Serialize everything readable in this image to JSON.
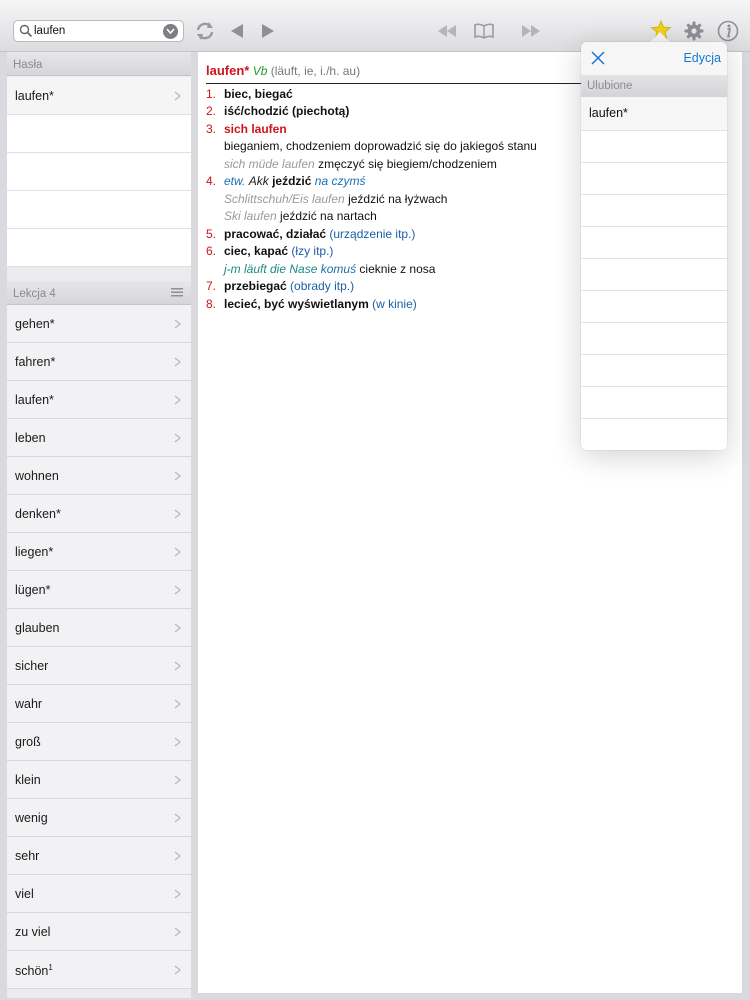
{
  "search": {
    "value": "laufen"
  },
  "colors": {
    "accent": "#1477d6",
    "headword": "#d0131b",
    "pos": "#1f9d2a",
    "star_active": "#f2d21b"
  },
  "toolbar": {
    "icons": [
      "search-icon",
      "clear-icon",
      "sync-icon",
      "back-icon",
      "forward-icon",
      "rewind-icon",
      "book-icon",
      "favorites-star-icon",
      "settings-gear-icon",
      "info-icon"
    ]
  },
  "sidebar": {
    "entries_header": "Hasła",
    "entries": [
      {
        "label": "laufen*"
      },
      {
        "label": ""
      },
      {
        "label": ""
      },
      {
        "label": ""
      },
      {
        "label": ""
      }
    ],
    "lesson_header": "Lekcja 4",
    "lesson_items": [
      {
        "label": "gehen*"
      },
      {
        "label": "fahren*"
      },
      {
        "label": "laufen*"
      },
      {
        "label": "leben"
      },
      {
        "label": "wohnen"
      },
      {
        "label": "denken*"
      },
      {
        "label": "liegen*"
      },
      {
        "label": "lügen*"
      },
      {
        "label": "glauben"
      },
      {
        "label": "sicher"
      },
      {
        "label": "wahr"
      },
      {
        "label": "groß"
      },
      {
        "label": "klein"
      },
      {
        "label": "wenig"
      },
      {
        "label": "sehr"
      },
      {
        "label": "viel"
      },
      {
        "label": "zu viel"
      },
      {
        "label": "schön",
        "sup": "1"
      }
    ]
  },
  "entry": {
    "headword": "laufen*",
    "pos": "Vb",
    "grammar": "(läuft, ie, i./h. au)",
    "senses": [
      {
        "num": "1.",
        "tr": "biec, biegać"
      },
      {
        "num": "2.",
        "tr": "iść/chodzić (piechotą)"
      },
      {
        "num": "3.",
        "tr": "sich laufen",
        "desc": "bieganiem, chodzeniem doprowadzić się do jakiegoś stanu",
        "ex": "sich müde laufen",
        "ex_tr": "zmęczyć się biegiem/chodzeniem"
      },
      {
        "num": "4.",
        "pre1": "etw.",
        "pre2": "Akk",
        "tr": "jeździć",
        "note": "na czymś",
        "ex1": "Schlittschuh/Eis laufen",
        "ex1_tr": "jeździć na łyżwach",
        "ex2": "Ski laufen",
        "ex2_tr": "jeździć na nartach"
      },
      {
        "num": "5.",
        "tr": "pracować, działać",
        "note": "(urządzenie itp.)"
      },
      {
        "num": "6.",
        "tr": "ciec, kapać",
        "note": "(łzy itp.)",
        "ex": "j-m läuft die Nase",
        "ex_b": "komuś",
        "ex_tr": "cieknie z nosa"
      },
      {
        "num": "7.",
        "tr": "przebiegać",
        "note": "(obrady itp.)"
      },
      {
        "num": "8.",
        "tr": "lecieć, być wyświetlanym",
        "note": "(w kinie)"
      }
    ]
  },
  "favorites": {
    "edit_label": "Edycja",
    "section": "Ulubione",
    "items": [
      "laufen*",
      "",
      "",
      "",
      "",
      "",
      "",
      "",
      "",
      "",
      ""
    ]
  }
}
